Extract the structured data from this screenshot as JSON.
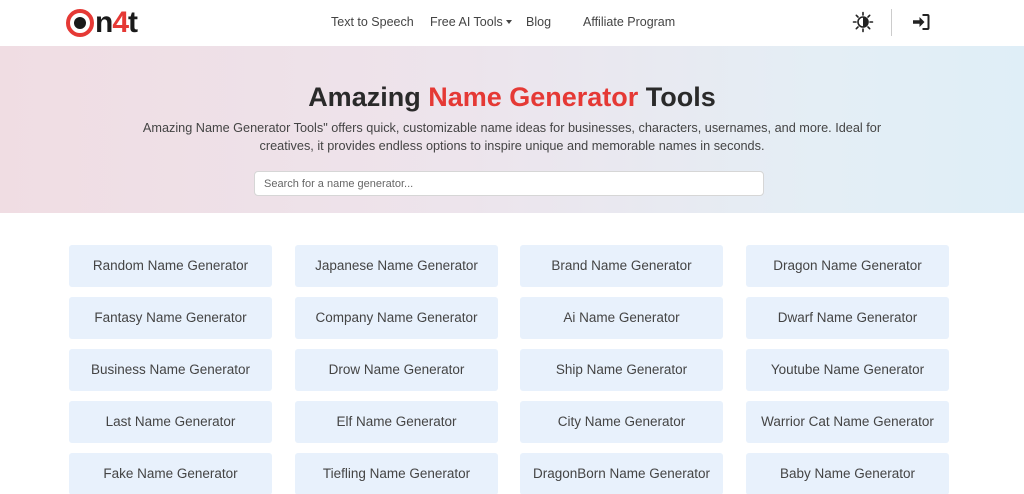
{
  "brand": {
    "logo_text_a": "n",
    "logo_text_4": "4",
    "logo_text_b": "t"
  },
  "nav": {
    "items": [
      "Text to Speech",
      "Free AI Tools",
      "Blog",
      "Affiliate Program"
    ]
  },
  "icons": {
    "theme": "brightness-icon",
    "login": "sign-in-icon"
  },
  "hero": {
    "title_pre": "Amazing ",
    "title_accent": "Name Generator",
    "title_post": " Tools",
    "description": "Amazing Name Generator Tools\" offers quick, customizable name ideas for businesses, characters, usernames, and more. Ideal for creatives, it provides endless options to inspire unique and memorable names in seconds.",
    "search_placeholder": "Search for a name generator..."
  },
  "colors": {
    "accent": "#e53935",
    "card_bg": "#e8f1fc"
  },
  "generators": [
    "Random Name Generator",
    "Japanese Name Generator",
    "Brand Name Generator",
    "Dragon Name Generator",
    "Fantasy Name Generator",
    "Company Name Generator",
    "Ai Name Generator",
    "Dwarf Name Generator",
    "Business Name Generator",
    "Drow Name Generator",
    "Ship Name Generator",
    "Youtube Name Generator",
    "Last Name Generator",
    "Elf Name Generator",
    "City Name Generator",
    "Warrior Cat Name Generator",
    "Fake Name Generator",
    "Tiefling Name Generator",
    "DragonBorn Name Generator",
    "Baby Name Generator"
  ]
}
